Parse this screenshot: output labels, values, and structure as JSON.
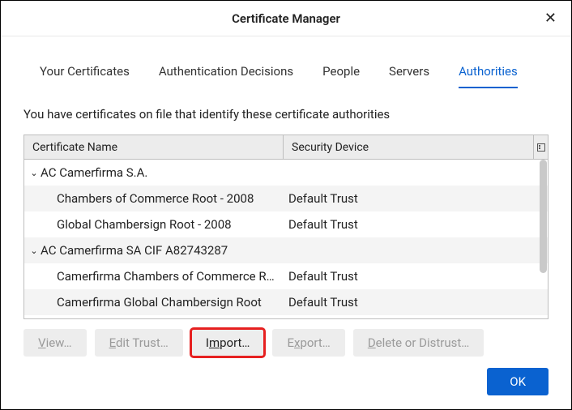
{
  "title": "Certificate Manager",
  "tabs": {
    "your_certificates": "Your Certificates",
    "authentication_decisions": "Authentication Decisions",
    "people": "People",
    "servers": "Servers",
    "authorities": "Authorities"
  },
  "description": "You have certificates on file that identify these certificate authorities",
  "columns": {
    "name": "Certificate Name",
    "device": "Security Device"
  },
  "rows": [
    {
      "type": "group",
      "name": "AC Camerfirma S.A.",
      "device": "",
      "alt": false
    },
    {
      "type": "leaf",
      "name": "Chambers of Commerce Root - 2008",
      "device": "Default Trust",
      "alt": true
    },
    {
      "type": "leaf",
      "name": "Global Chambersign Root - 2008",
      "device": "Default Trust",
      "alt": false
    },
    {
      "type": "group",
      "name": "AC Camerfirma SA CIF A82743287",
      "device": "",
      "alt": true
    },
    {
      "type": "leaf",
      "name": "Camerfirma Chambers of Commerce R…",
      "device": "Default Trust",
      "alt": false
    },
    {
      "type": "leaf",
      "name": "Camerfirma Global Chambersign Root",
      "device": "Default Trust",
      "alt": true
    }
  ],
  "buttons": {
    "view": "View…",
    "edit_trust": "Edit Trust…",
    "import": "Import…",
    "export": "Export…",
    "delete_distrust": "Delete or Distrust…",
    "ok": "OK"
  }
}
